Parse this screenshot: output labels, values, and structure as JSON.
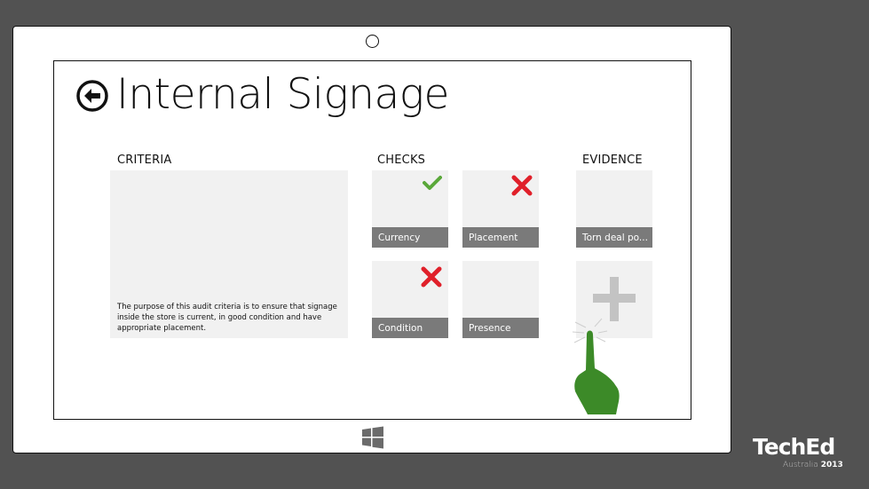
{
  "page": {
    "title": "Internal Signage",
    "back_icon": "back-arrow-circle-icon"
  },
  "criteria": {
    "label": "CRITERIA",
    "description": "The purpose of this audit criteria is to ensure that signage inside the store is current, in good condition and have appropriate placement."
  },
  "checks": {
    "label": "CHECKS",
    "items": [
      {
        "label": "Currency",
        "status": "pass",
        "icon": "checkmark-icon",
        "color": "#5aa83a"
      },
      {
        "label": "Placement",
        "status": "fail",
        "icon": "cross-icon",
        "color": "#e0202a"
      },
      {
        "label": "Condition",
        "status": "fail",
        "icon": "cross-icon",
        "color": "#e0202a"
      },
      {
        "label": "Presence",
        "status": "none",
        "icon": "",
        "color": ""
      }
    ]
  },
  "evidence": {
    "label": "EVIDENCE",
    "items": [
      {
        "label": "Torn deal po..."
      }
    ],
    "add_icon": "plus-icon"
  },
  "overlay": {
    "gesture_icon": "tap-hand-icon",
    "gesture_color": "#3c8a28"
  },
  "branding": {
    "name": "TechEd",
    "location": "Australia",
    "year": "2013"
  },
  "device": {
    "camera_icon": "camera-icon",
    "start_icon": "windows-logo-icon"
  }
}
